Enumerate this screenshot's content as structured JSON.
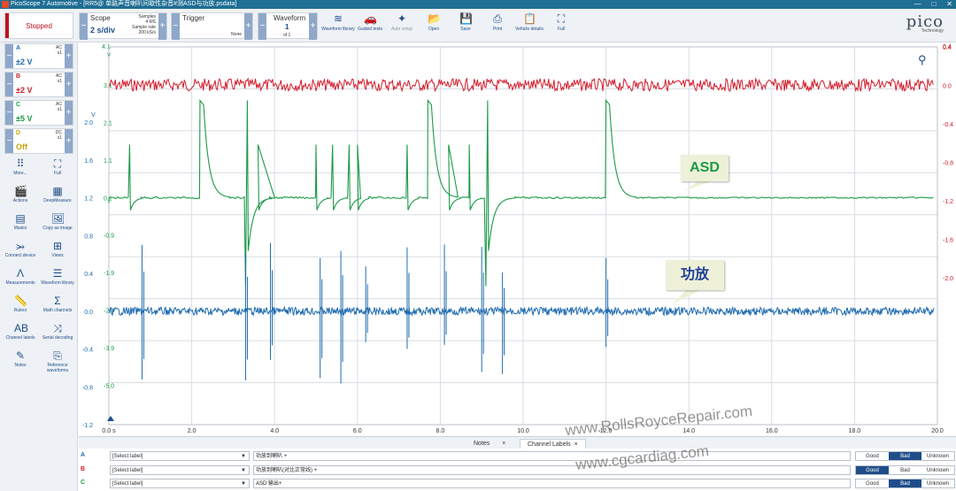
{
  "title": "PicoScope 7 Automotive - [RR5@ 单路声音喇叭间歇性杂音#测ASD与功放.psdata]",
  "window_controls": [
    "—",
    "□",
    "✕"
  ],
  "status_button": "Stopped",
  "scope": {
    "label": "Scope",
    "timebase": "2 s/div",
    "samples_label": "Samples",
    "samples": "4 MS",
    "rate_label": "Sample rate",
    "rate": "200 kS/s"
  },
  "trigger": {
    "label": "Trigger",
    "mode": "None"
  },
  "waveform": {
    "label": "Waveform",
    "index": "1",
    "of": "of 1"
  },
  "toolbar_buttons": [
    {
      "label": "Waveform library",
      "icon": "waveform-library-icon",
      "glyph": "≋"
    },
    {
      "label": "Guided tests",
      "icon": "car-icon",
      "glyph": "🚗"
    },
    {
      "label": "Auto setup",
      "icon": "wand-icon",
      "glyph": "✦"
    },
    {
      "label": "Open",
      "icon": "folder-icon",
      "glyph": "📂"
    },
    {
      "label": "Save",
      "icon": "save-icon",
      "glyph": "💾"
    },
    {
      "label": "Print",
      "icon": "print-icon",
      "glyph": "⎙"
    },
    {
      "label": "Vehicle details",
      "icon": "clipboard-icon",
      "glyph": "📋"
    },
    {
      "label": "Full",
      "icon": "fullscreen-icon",
      "glyph": "⛶"
    }
  ],
  "logo": {
    "name": "pico",
    "sub": "Technology"
  },
  "channels": [
    {
      "name": "A",
      "coupling": "AC",
      "probe": "x1",
      "range": "±2 V",
      "color": "#1f6cb0"
    },
    {
      "name": "B",
      "coupling": "AC",
      "probe": "x1",
      "range": "±2 V",
      "color": "#d21c2c"
    },
    {
      "name": "C",
      "coupling": "AC",
      "probe": "x1",
      "range": "±5 V",
      "color": "#1c9a48"
    },
    {
      "name": "D",
      "coupling": "DC",
      "probe": "x1",
      "range": "Off",
      "color": "#c9a30c"
    }
  ],
  "tools": [
    {
      "label": "More...",
      "icon": "grid-icon",
      "glyph": "⠿"
    },
    {
      "label": "Full",
      "icon": "fullscreen-icon",
      "glyph": "⛶"
    },
    {
      "label": "Actions",
      "icon": "actions-icon",
      "glyph": "🎬"
    },
    {
      "label": "DeepMeasure",
      "icon": "deepmeasure-icon",
      "glyph": "▦"
    },
    {
      "label": "Masks",
      "icon": "masks-icon",
      "glyph": "▤"
    },
    {
      "label": "Copy as image",
      "icon": "image-icon",
      "glyph": "🖼"
    },
    {
      "label": "Connect device",
      "icon": "usb-icon",
      "glyph": "⭃"
    },
    {
      "label": "Views",
      "icon": "views-icon",
      "glyph": "⊞"
    },
    {
      "label": "Measurements",
      "icon": "measure-icon",
      "glyph": "Λ"
    },
    {
      "label": "Waveform library",
      "icon": "library-icon",
      "glyph": "☰"
    },
    {
      "label": "Rulers",
      "icon": "ruler-icon",
      "glyph": "📏"
    },
    {
      "label": "Math channels",
      "icon": "sigma-icon",
      "glyph": "Σ"
    },
    {
      "label": "Channel labels",
      "icon": "abcd-icon",
      "glyph": "AB"
    },
    {
      "label": "Serial decoding",
      "icon": "serial-icon",
      "glyph": "⤨"
    },
    {
      "label": "Notes",
      "icon": "notes-icon",
      "glyph": "✎"
    },
    {
      "label": "Reference waveforms",
      "icon": "reference-icon",
      "glyph": "⎘"
    }
  ],
  "colors": {
    "A": "#1f6cb0",
    "B": "#d21c2c",
    "C": "#1c9a48",
    "grid": "#d7dde4"
  },
  "chart_data": {
    "type": "line",
    "xlim": [
      0,
      20
    ],
    "x_ticks": [
      "0.0 s",
      "2.0",
      "4.0",
      "6.0",
      "8.0",
      "10.0",
      "12.0",
      "14.0",
      "16.0",
      "18.0",
      "20.0"
    ],
    "axis_A": {
      "unit": "V",
      "ticks": [
        "2.0",
        "1.6",
        "1.2",
        "0.8",
        "0.4",
        "0.0",
        "-0.4",
        "-0.8",
        "-1.2"
      ]
    },
    "axis_C": {
      "ticks": [
        "3.1",
        "2.1",
        "1.1",
        "0.1",
        "-0.9",
        "-1.9",
        "-2.9",
        "-3.9",
        "-5.0"
      ],
      "unit": "V"
    },
    "axis_B": {
      "ticks": [
        "0.4",
        "0.0",
        "-0.4",
        "-0.8",
        "-1.2",
        "-1.6",
        "-2.0"
      ]
    },
    "axis_top": {
      "left": "4.1",
      "left_unit": "V",
      "right": "0.4"
    },
    "series": [
      {
        "channel": "B",
        "level": 2.45,
        "noise": 0.05
      },
      {
        "channel": "C",
        "baseline": 1.2,
        "spikes": [
          0.5,
          2.2,
          3.3,
          3.6,
          5.0,
          5.4,
          5.8,
          6.0,
          7.2,
          7.7,
          8.2,
          8.7,
          9.1,
          12.0
        ]
      },
      {
        "channel": "A",
        "baseline": 0.0,
        "spikes": [
          0.8,
          3.3,
          3.9,
          5.1,
          5.6,
          6.2,
          7.2,
          8.1,
          9.0,
          9.5,
          12.0
        ]
      }
    ]
  },
  "callouts": [
    {
      "text": "ASD",
      "color": "#1c9a48"
    },
    {
      "text": "功放",
      "color": "#1f3f9a"
    }
  ],
  "bottom_tabs": [
    {
      "label": "Notes"
    },
    {
      "label": "Channel Labels"
    }
  ],
  "label_rows": [
    {
      "ch": "A",
      "select": "[Select label]",
      "text": "功放到喇叭 +",
      "state": "Bad"
    },
    {
      "ch": "B",
      "select": "[Select label]",
      "text": "功放到喇叭(对比正常线) +",
      "state": "Good"
    },
    {
      "ch": "C",
      "select": "[Select label]",
      "text": "ASD 输出+",
      "state": "Bad"
    }
  ],
  "rating_options": [
    "Good",
    "Bad",
    "Unknown"
  ],
  "watermarks": [
    "www.RollsRoyceRepair.com",
    "www.cgcardiag.com"
  ]
}
